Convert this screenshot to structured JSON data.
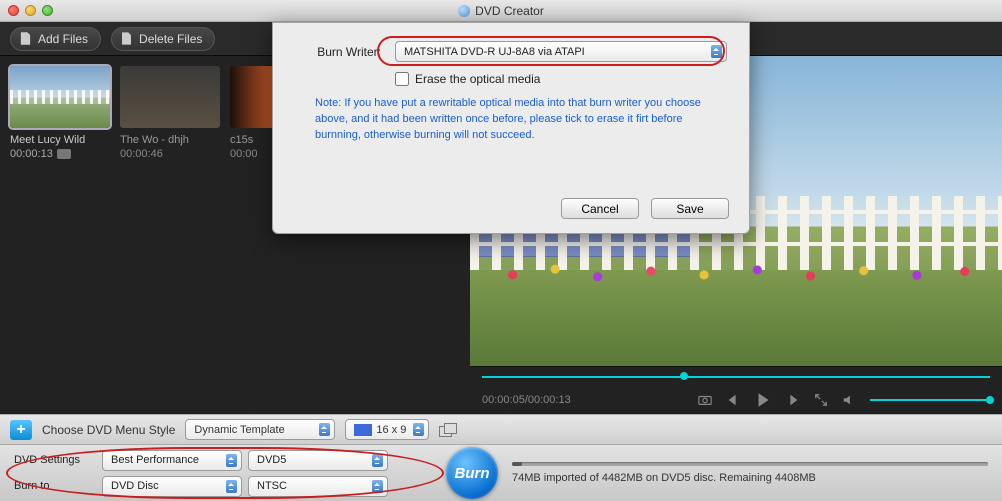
{
  "window": {
    "title": "DVD Creator"
  },
  "toolbar": {
    "add_files": "Add Files",
    "delete_files": "Delete Files"
  },
  "thumbs": [
    {
      "title": "Meet Lucy Wild",
      "time": "00:00:13"
    },
    {
      "title": "The Wo - dhjh",
      "time": "00:00:46"
    },
    {
      "title": "c15s",
      "time": "00:00"
    }
  ],
  "player": {
    "time": "00:00:05/00:00:13",
    "seek_percent": 38
  },
  "menubar": {
    "choose": "Choose DVD Menu Style",
    "template": "Dynamic Template",
    "ratio": "16 x 9"
  },
  "bottom": {
    "label_settings": "DVD Settings",
    "label_burn_to": "Burn to",
    "perf": "Best Performance",
    "disc_type": "DVD5",
    "burn_target": "DVD Disc",
    "format": "NTSC",
    "burn": "Burn",
    "status": "74MB imported of 4482MB on DVD5 disc. Remaining 4408MB"
  },
  "dialog": {
    "label": "Burn Writer:",
    "writer": "MATSHITA DVD-R   UJ-8A8 via ATAPI",
    "erase": "Erase the optical media",
    "note": "Note: If you have put a rewritable optical media into that burn writer you choose above, and it had been written once before, please tick to erase it firt before burnning, otherwise burning will not succeed.",
    "cancel": "Cancel",
    "save": "Save"
  }
}
